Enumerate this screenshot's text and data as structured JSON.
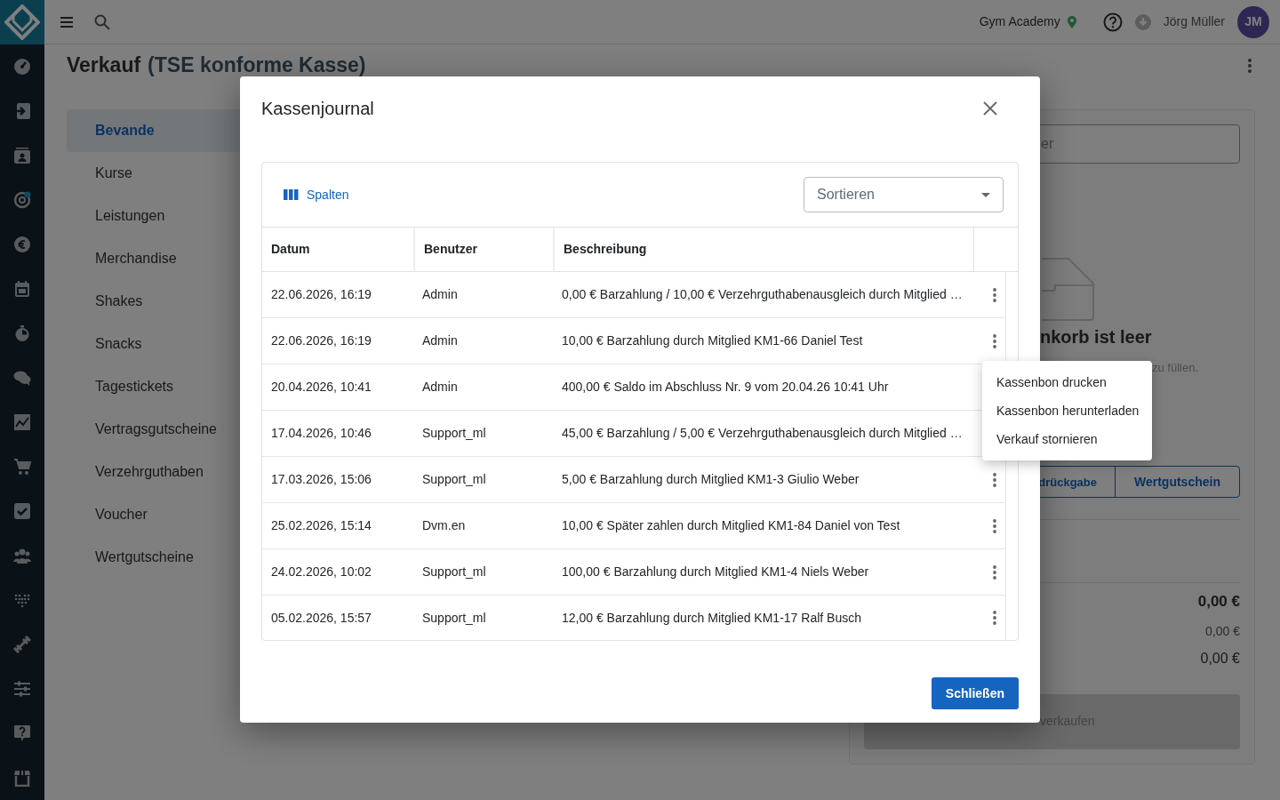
{
  "topbar": {
    "studio": "Gym Academy",
    "user": "Jörg Müller",
    "avatar_initials": "JM"
  },
  "page": {
    "title": "Verkauf",
    "subtitle": "(TSE konforme Kasse)",
    "categories": [
      {
        "label": "Bevande",
        "selected": true
      },
      {
        "label": "Kurse",
        "selected": false
      },
      {
        "label": "Leistungen",
        "selected": false
      },
      {
        "label": "Merchandise",
        "selected": false
      },
      {
        "label": "Shakes",
        "selected": false
      },
      {
        "label": "Snacks",
        "selected": false
      },
      {
        "label": "Tagestickets",
        "selected": false
      },
      {
        "label": "Vertragsgutscheine",
        "selected": false
      },
      {
        "label": "Verzehrguthaben",
        "selected": false
      },
      {
        "label": "Voucher",
        "selected": false
      },
      {
        "label": "Wertgutscheine",
        "selected": false
      }
    ],
    "cart": {
      "search_placeholder": "er",
      "empty_title": "nkorb ist leer",
      "empty_hint": "zu füllen.",
      "buttons": [
        "drückgabe",
        "Wertgutschein"
      ],
      "totals": [
        "0,00 €",
        "0,00 €",
        "0,00 €"
      ],
      "checkout": "verkaufen"
    }
  },
  "modal": {
    "title": "Kassenjournal",
    "columns_button": "Spalten",
    "sort_placeholder": "Sortieren",
    "columns": [
      "Datum",
      "Benutzer",
      "Beschreibung"
    ],
    "rows": [
      {
        "date": "22.06.2026, 16:19",
        "user": "Admin",
        "description": "0,00 € Barzahlung / 10,00 € Verzehrguthabenausgleich durch Mitglied …"
      },
      {
        "date": "22.06.2026, 16:19",
        "user": "Admin",
        "description": "10,00 € Barzahlung durch Mitglied KM1-66 Daniel Test"
      },
      {
        "date": "20.04.2026, 10:41",
        "user": "Admin",
        "description": "400,00 € Saldo im Abschluss Nr. 9 vom 20.04.26 10:41 Uhr"
      },
      {
        "date": "17.04.2026, 10:46",
        "user": "Support_ml",
        "description": "45,00 € Barzahlung / 5,00 € Verzehrguthabenausgleich durch Mitglied …"
      },
      {
        "date": "17.03.2026, 15:06",
        "user": "Support_ml",
        "description": "5,00 € Barzahlung durch Mitglied KM1-3 Giulio Weber"
      },
      {
        "date": "25.02.2026, 15:14",
        "user": "Dvm.en",
        "description": "10,00 € Später zahlen durch Mitglied KM1-84 Daniel von Test"
      },
      {
        "date": "24.02.2026, 10:02",
        "user": "Support_ml",
        "description": "100,00 € Barzahlung durch Mitglied KM1-4 Niels Weber"
      },
      {
        "date": "05.02.2026, 15:57",
        "user": "Support_ml",
        "description": "12,00 € Barzahlung durch Mitglied KM1-17 Ralf Busch"
      }
    ],
    "menu": [
      "Kassenbon drucken",
      "Kassenbon herunterladen",
      "Verkauf stornieren"
    ],
    "close_button": "Schließen"
  }
}
